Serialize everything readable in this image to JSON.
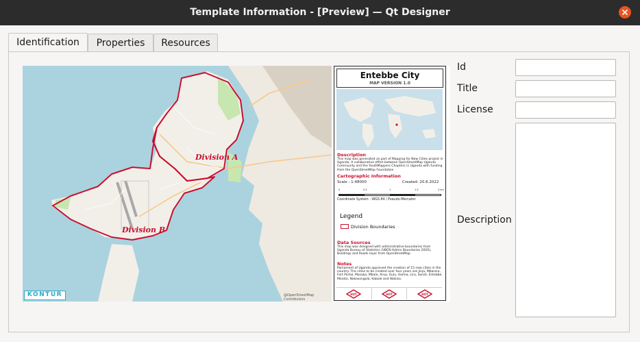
{
  "window": {
    "title": "Template Information - [Preview] — Qt Designer"
  },
  "tabs": [
    {
      "label": "Identification",
      "active": true
    },
    {
      "label": "Properties",
      "active": false
    },
    {
      "label": "Resources",
      "active": false
    }
  ],
  "preview": {
    "map": {
      "labels": [
        "Division A",
        "Division B"
      ],
      "brand": "KONTUR",
      "attribution": "@OpenStreetMap Contributors"
    },
    "layout": {
      "title": "Entebbe City",
      "subtitle": "MAP VERSION 1.0",
      "description_heading": "Description",
      "description_text": "This map was generated as part of Mapping for New Cities project in Uganda. A collaborative effort between OpenStreetMap Uganda Community and the YouthMappers Chapters in Uganda with funding from the OpenStreetMap Foundation",
      "cartographic_heading": "Cartographic Information",
      "scale": "Scale : 1:48000",
      "created": "Created: 20.6.2022",
      "scale_ticks": [
        "0",
        "0.5",
        "1",
        "1.5",
        "2 km"
      ],
      "coordinate_system": "Coordinate System : WGS 84 / Pseudo-Mercator",
      "legend_heading": "Legend",
      "legend_item": "Division Boundaries",
      "data_sources_heading": "Data Sources",
      "data_sources_text": "This map was designed with administrative boundaries from Uganda Bureau of Statistics (UBOS-Admin Boundaries 2020), Buildings and Roads layer from OpenStreetMap",
      "notes_heading": "Notes",
      "notes_text": "Parliament of Uganda approved the creation of 15 new cities in the country. The cities to be created over four years are Jinja, Mbarara, Fort Portal, Masaka, Mbale, Arua, Gulu, Hoima, Lira, Soroti, Entebbe, Moroto, Nakasongola, Kabale and Wakiso.",
      "logos": [
        "HOT",
        "HOT",
        "HOT"
      ],
      "boundary_color": "#c8102e"
    }
  },
  "form": {
    "id_label": "Id",
    "title_label": "Title",
    "license_label": "License",
    "description_label": "Description",
    "id_value": "",
    "title_value": "",
    "license_value": ""
  },
  "icons": {
    "close": "close-icon"
  }
}
